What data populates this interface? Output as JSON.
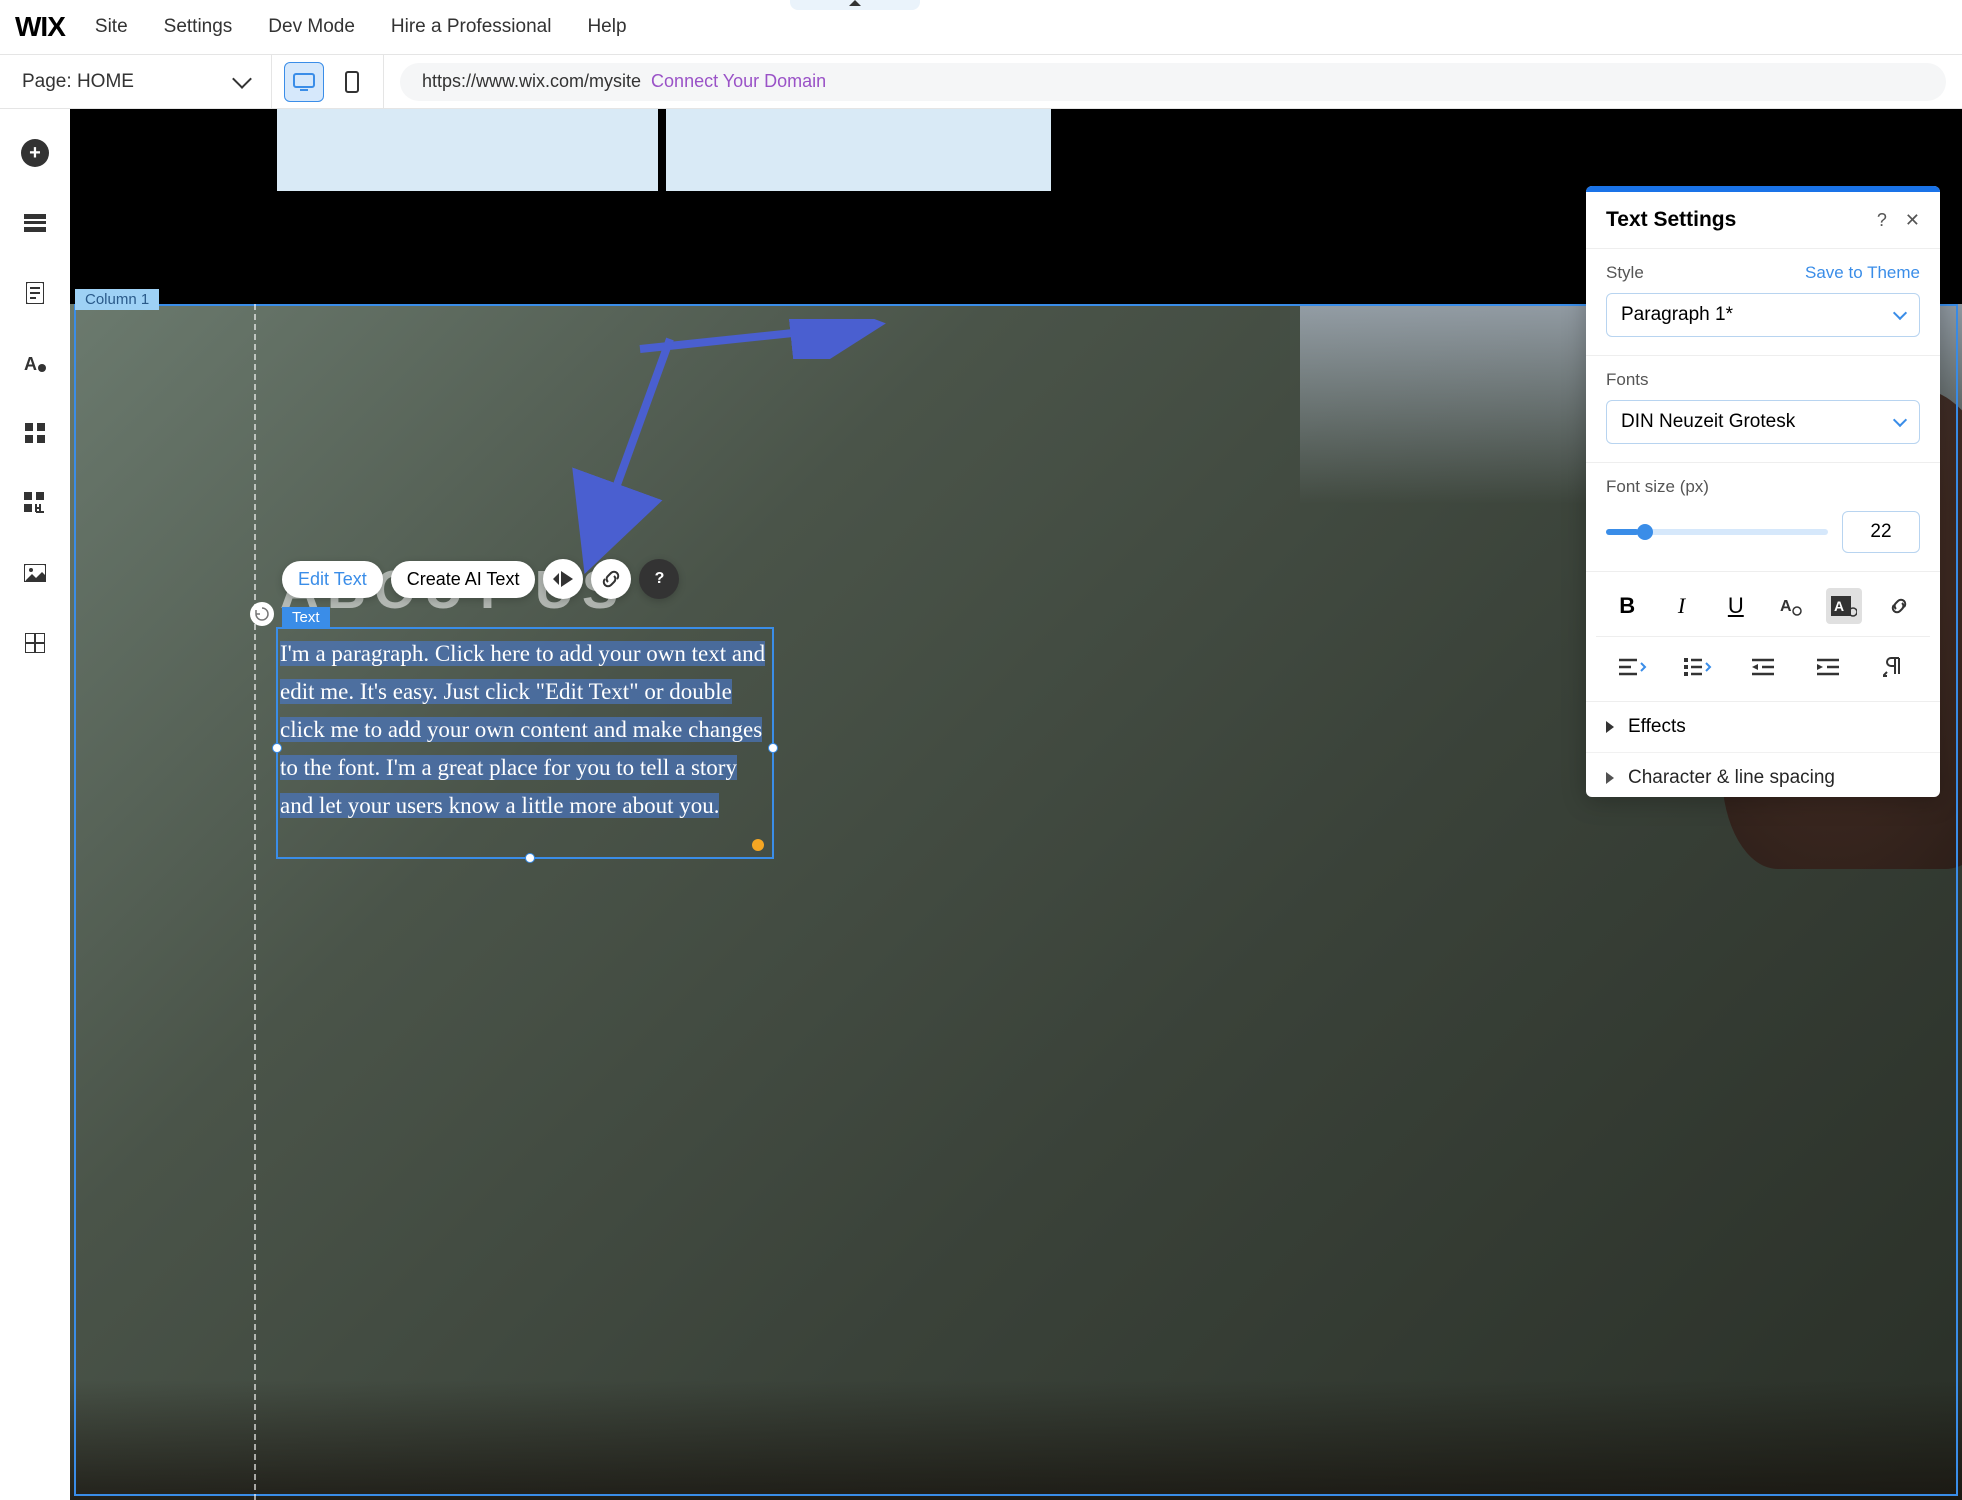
{
  "logo": "WIX",
  "menu": {
    "site": "Site",
    "settings": "Settings",
    "dev": "Dev Mode",
    "hire": "Hire a Professional",
    "help": "Help"
  },
  "page": {
    "prefix": "Page: ",
    "name": "HOME"
  },
  "url": {
    "value": "https://www.wix.com/mysite",
    "connect": "Connect Your Domain"
  },
  "canvas": {
    "column_label": "Column 1",
    "heading": "ABOUT US",
    "toolbar": {
      "edit": "Edit Text",
      "ai": "Create AI Text"
    },
    "text_label": "Text",
    "paragraph": "I'm a paragraph. Click here to add your own text and edit me. It's easy. Just click \"Edit Text\" or double click me to add your own content and make changes to the font. I'm a great place for you to tell a story and let your users know a little more about you."
  },
  "panel": {
    "title": "Text Settings",
    "style_label": "Style",
    "save_theme": "Save to Theme",
    "style_value": "Paragraph 1*",
    "fonts_label": "Fonts",
    "font_value": "DIN Neuzeit Grotesk",
    "size_label": "Font size (px)",
    "size_value": "22",
    "effects": "Effects",
    "spacing": "Character & line spacing"
  },
  "icons": {
    "help": "?",
    "close": "✕",
    "bold": "B",
    "italic": "I",
    "underline": "U"
  }
}
